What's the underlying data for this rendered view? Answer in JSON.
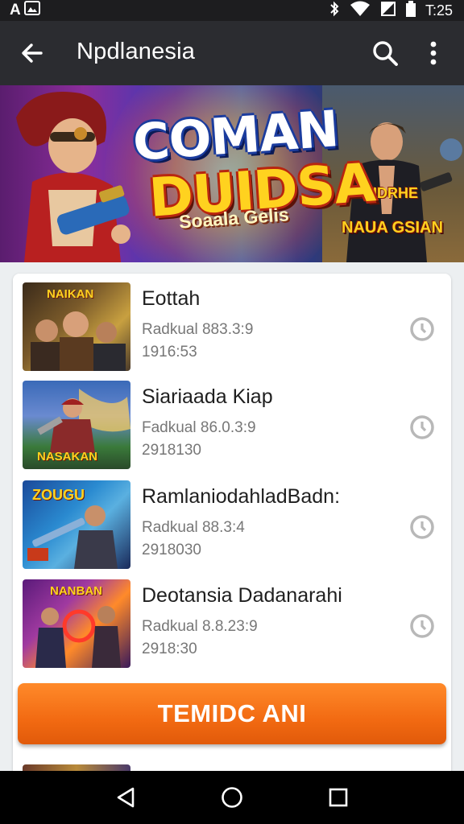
{
  "status_bar": {
    "left_text": "A",
    "time": "T:25",
    "icons": [
      "photo-icon",
      "bluetooth-icon",
      "wifi-icon",
      "signal-icon",
      "battery-icon"
    ]
  },
  "app_bar": {
    "title": "Npdlanesia",
    "icons": [
      "back-arrow-icon",
      "search-icon",
      "more-vert-icon"
    ]
  },
  "banner": {
    "title_line1": "COMAN",
    "title_line2": "DUIDSA",
    "subtitle": "Soaala Gelis",
    "tag_top": "ZNAIDRHE",
    "tag_bottom": "NAUA GSIAN"
  },
  "list": {
    "items": [
      {
        "title": "Eottah",
        "line1": "Radkual 883.3:9",
        "line2": "1916:53",
        "thumb_text": "NAIKAN"
      },
      {
        "title": "Siariaada Kiap",
        "line1": "Fadkual 86.0.3:9",
        "line2": "2918130",
        "thumb_text": "NASAKAN"
      },
      {
        "title": "RamlaniodahladBadn:",
        "line1": "Radkual 88.3:4",
        "line2": "2918030",
        "thumb_text": "ZOUGU"
      },
      {
        "title": "Deotansia Dadanarahi",
        "line1": "Radkual 8.8.23:9",
        "line2": "2918:30",
        "thumb_text": "NANBAN"
      }
    ],
    "action_icon": "clock-icon"
  },
  "cta": {
    "label": "TEMIDC ANI"
  },
  "nav_bar": {
    "icons": [
      "back-triangle-icon",
      "home-circle-icon",
      "recents-square-icon"
    ]
  },
  "colors": {
    "app_bar": "#2b2c30",
    "status_bar": "#1d1d1f",
    "cta": "#f26a12",
    "background": "#eceff1"
  }
}
